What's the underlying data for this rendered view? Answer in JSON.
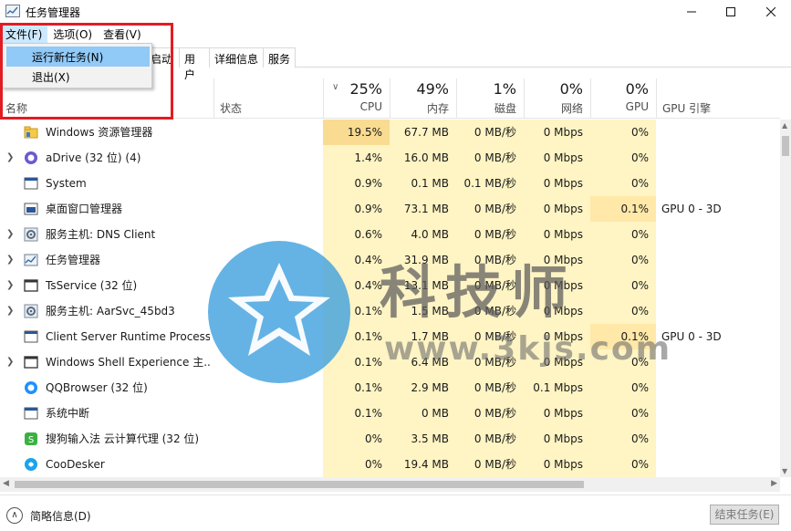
{
  "window": {
    "title": "任务管理器"
  },
  "menubar": [
    "文件(F)",
    "选项(O)",
    "查看(V)"
  ],
  "file_menu": {
    "items": [
      "运行新任务(N)",
      "退出(X)"
    ]
  },
  "tabs": [
    "启动",
    "用户",
    "详细信息",
    "服务"
  ],
  "columns": {
    "name": "名称",
    "status": "状态",
    "cpu": {
      "pct": "25%",
      "label": "CPU"
    },
    "memory": {
      "pct": "49%",
      "label": "内存"
    },
    "disk": {
      "pct": "1%",
      "label": "磁盘"
    },
    "network": {
      "pct": "0%",
      "label": "网络"
    },
    "gpu": {
      "pct": "0%",
      "label": "GPU"
    },
    "gpu_engine": "GPU 引擎"
  },
  "processes": [
    {
      "name": "Windows 资源管理器",
      "expand": false,
      "cpu": "19.5%",
      "mem": "67.7 MB",
      "disk": "0 MB/秒",
      "net": "0 Mbps",
      "gpu": "0%",
      "engine": "",
      "icon": "folder-icon"
    },
    {
      "name": "aDrive (32 位) (4)",
      "expand": true,
      "cpu": "1.4%",
      "mem": "16.0 MB",
      "disk": "0 MB/秒",
      "net": "0 Mbps",
      "gpu": "0%",
      "engine": "",
      "icon": "adrive-icon"
    },
    {
      "name": "System",
      "expand": false,
      "cpu": "0.9%",
      "mem": "0.1 MB",
      "disk": "0.1 MB/秒",
      "net": "0 Mbps",
      "gpu": "0%",
      "engine": "",
      "icon": "system-icon"
    },
    {
      "name": "桌面窗口管理器",
      "expand": false,
      "cpu": "0.9%",
      "mem": "73.1 MB",
      "disk": "0 MB/秒",
      "net": "0 Mbps",
      "gpu": "0.1%",
      "engine": "GPU 0 - 3D",
      "icon": "dwm-icon"
    },
    {
      "name": "服务主机: DNS Client",
      "expand": true,
      "cpu": "0.6%",
      "mem": "4.0 MB",
      "disk": "0 MB/秒",
      "net": "0 Mbps",
      "gpu": "0%",
      "engine": "",
      "icon": "gear-icon"
    },
    {
      "name": "任务管理器",
      "expand": true,
      "cpu": "0.4%",
      "mem": "31.9 MB",
      "disk": "0 MB/秒",
      "net": "0 Mbps",
      "gpu": "0%",
      "engine": "",
      "icon": "taskmgr-icon"
    },
    {
      "name": "TsService (32 位)",
      "expand": true,
      "cpu": "0.4%",
      "mem": "13.1 MB",
      "disk": "0 MB/秒",
      "net": "0 Mbps",
      "gpu": "0%",
      "engine": "",
      "icon": "window-icon"
    },
    {
      "name": "服务主机: AarSvc_45bd3",
      "expand": true,
      "cpu": "0.1%",
      "mem": "1.5 MB",
      "disk": "0 MB/秒",
      "net": "0 Mbps",
      "gpu": "0%",
      "engine": "",
      "icon": "gear-icon"
    },
    {
      "name": "Client Server Runtime Process",
      "expand": false,
      "cpu": "0.1%",
      "mem": "1.7 MB",
      "disk": "0 MB/秒",
      "net": "0 Mbps",
      "gpu": "0.1%",
      "engine": "GPU 0 - 3D",
      "icon": "system-icon"
    },
    {
      "name": "Windows Shell Experience 主...",
      "expand": true,
      "cpu": "0.1%",
      "mem": "6.4 MB",
      "disk": "0 MB/秒",
      "net": "0 Mbps",
      "gpu": "0%",
      "engine": "",
      "icon": "window-icon"
    },
    {
      "name": "QQBrowser (32 位)",
      "expand": false,
      "cpu": "0.1%",
      "mem": "2.9 MB",
      "disk": "0 MB/秒",
      "net": "0.1 Mbps",
      "gpu": "0%",
      "engine": "",
      "icon": "qqbrowser-icon"
    },
    {
      "name": "系统中断",
      "expand": false,
      "cpu": "0.1%",
      "mem": "0 MB",
      "disk": "0 MB/秒",
      "net": "0 Mbps",
      "gpu": "0%",
      "engine": "",
      "icon": "system-icon"
    },
    {
      "name": "搜狗输入法 云计算代理 (32 位)",
      "expand": false,
      "cpu": "0%",
      "mem": "3.5 MB",
      "disk": "0 MB/秒",
      "net": "0 Mbps",
      "gpu": "0%",
      "engine": "",
      "icon": "sogou-icon"
    },
    {
      "name": "CooDesker",
      "expand": false,
      "cpu": "0%",
      "mem": "19.4 MB",
      "disk": "0 MB/秒",
      "net": "0 Mbps",
      "gpu": "0%",
      "engine": "",
      "icon": "coodesker-icon"
    }
  ],
  "footer": {
    "fewer_details": "简略信息(D)",
    "end_task": "结束任务(E)"
  },
  "watermark": {
    "text": "科技师",
    "url": "www.3kjs.com"
  }
}
